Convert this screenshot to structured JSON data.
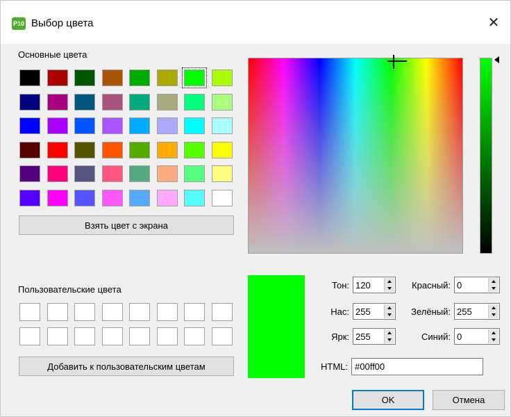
{
  "window": {
    "title": "Выбор цвета",
    "app_icon_text": "P10",
    "close_glyph": "✕"
  },
  "basic_colors": {
    "label": "Основные цвета",
    "selected_index": 6,
    "swatches": [
      "#000000",
      "#aa0000",
      "#005500",
      "#aa5500",
      "#00aa00",
      "#aaaa00",
      "#00ff00",
      "#aaff00",
      "#00007f",
      "#aa007f",
      "#00557f",
      "#aa557f",
      "#00aa7f",
      "#aaaa7f",
      "#00ff7f",
      "#aaff7f",
      "#0000ff",
      "#aa00ff",
      "#0055ff",
      "#aa55ff",
      "#00aaff",
      "#aaaaff",
      "#00ffff",
      "#aaffff",
      "#550000",
      "#ff0000",
      "#555500",
      "#ff5500",
      "#55aa00",
      "#ffaa00",
      "#55ff00",
      "#ffff00",
      "#55007f",
      "#ff007f",
      "#55557f",
      "#ff557f",
      "#55aa7f",
      "#ffaa7f",
      "#55ff7f",
      "#ffff7f",
      "#5500ff",
      "#ff00ff",
      "#5555ff",
      "#ff55ff",
      "#55aaff",
      "#ffaaff",
      "#55ffff",
      "#ffffff"
    ],
    "pick_screen_button": "Взять цвет с экрана"
  },
  "custom_colors": {
    "label": "Пользовательские цвета",
    "count": 16,
    "add_button": "Добавить к пользовательским цветам"
  },
  "current_color": "#00ff00",
  "fields": {
    "hue_label": "Тон:",
    "hue": "120",
    "sat_label": "Нас:",
    "sat": "255",
    "val_label": "Ярк:",
    "val": "255",
    "red_label": "Красный:",
    "red": "0",
    "green_label": "Зелёный:",
    "green": "255",
    "blue_label": "Синий:",
    "blue": "0",
    "html_label": "HTML:",
    "html": "#00ff00"
  },
  "buttons": {
    "ok": "OK",
    "cancel": "Отмена"
  }
}
